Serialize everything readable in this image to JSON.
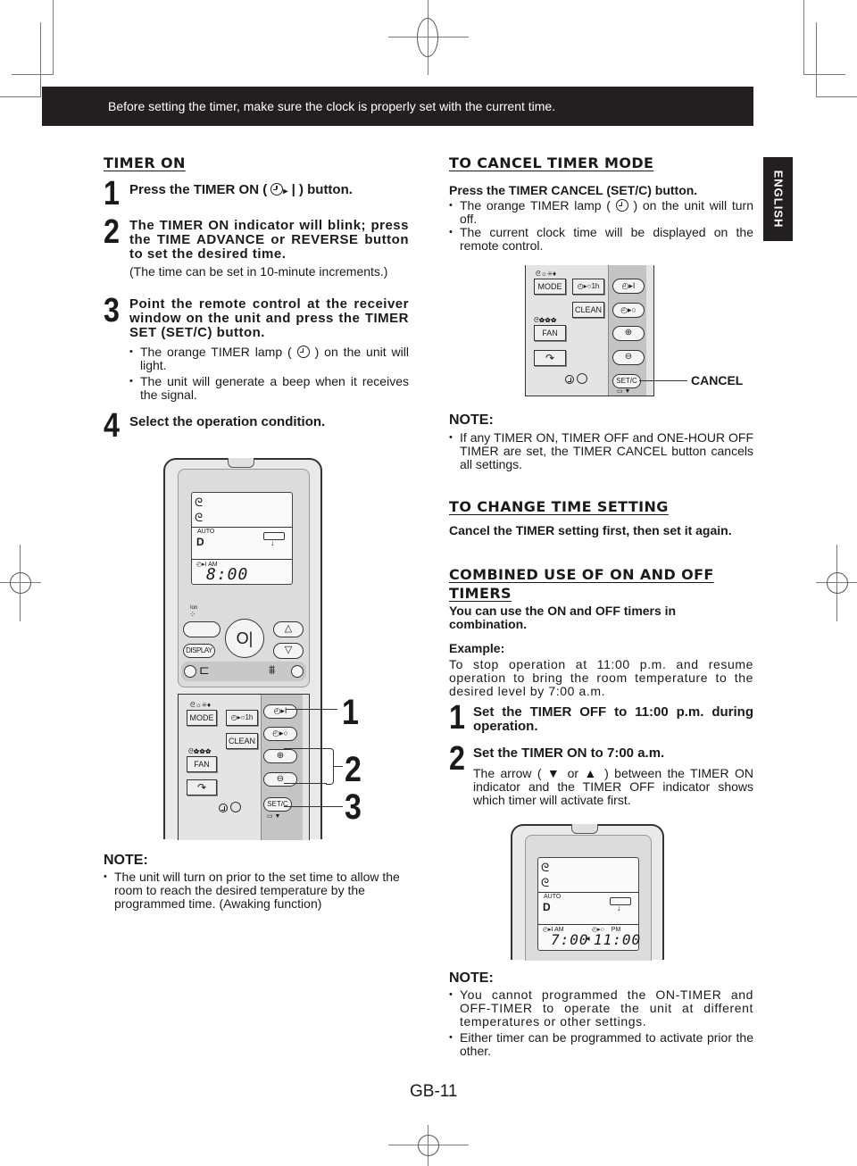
{
  "banner": "Before setting the timer, make sure the clock is properly set with the current time.",
  "language_tab": "ENGLISH",
  "page_number": "GB-11",
  "timer_on": {
    "heading": "TIMER ON ",
    "steps": [
      {
        "num": "1",
        "title_before": "Press the TIMER ON (",
        "title_after": ") button."
      },
      {
        "num": "2",
        "title": "The TIMER ON indicator will blink; press the TIME ADVANCE or REVERSE button to set the desired time.",
        "sub": "(The time can be set in 10-minute increments.)"
      },
      {
        "num": "3",
        "title": "Point the remote control at the receiver window on the unit and press the TIMER SET (SET/C) button.",
        "bullets": [
          {
            "before": "The orange TIMER lamp (",
            "after": ") on the unit will light."
          },
          {
            "text": "The unit will generate a beep when it receives the signal."
          }
        ]
      },
      {
        "num": "4",
        "title": "Select the operation condition."
      }
    ],
    "callouts": [
      "1",
      "2",
      "3"
    ],
    "note": {
      "title": "NOTE:",
      "bullets": [
        "The unit will turn on prior to the set time to allow the room to reach the desired temperature by the programmed time. (Awaking function)"
      ]
    }
  },
  "remote": {
    "lcd": {
      "auto": "AUTO",
      "timer_on_label": "AM",
      "time": "8:00"
    },
    "ion": "Ion",
    "display": "DISPLAY",
    "buttons": {
      "mode": "MODE",
      "one_hour": "1h",
      "clean": "CLEAN",
      "fan": "FAN",
      "setc": "SET/C"
    }
  },
  "cancel": {
    "heading": "TO CANCEL TIMER MODE",
    "instruction": "Press the TIMER CANCEL (SET/C) button.",
    "bullets": [
      {
        "before": "The orange TIMER lamp (",
        "after": ") on the unit will turn off."
      },
      {
        "text": "The current clock time will be displayed on the remote control."
      }
    ],
    "callout_label": "CANCEL",
    "note": {
      "title": "NOTE:",
      "bullets": [
        "If any TIMER ON, TIMER OFF and ONE-HOUR OFF TIMER are set, the TIMER CANCEL button cancels all settings."
      ]
    }
  },
  "change_time": {
    "heading": "TO CHANGE TIME SETTING",
    "instruction": "Cancel the TIMER setting first, then set it again."
  },
  "combined": {
    "heading": "COMBINED USE OF ON AND OFF TIMERS",
    "intro": "You can use the ON and OFF timers in combination.",
    "example_label": "Example:",
    "example_text": "To stop operation at 11:00 p.m. and resume operation to bring the room temperature to the desired level by 7:00 a.m.",
    "steps": [
      {
        "num": "1",
        "title": "Set the TIMER OFF to 11:00 p.m. during operation."
      },
      {
        "num": "2",
        "title": "Set the TIMER ON to 7:00 a.m.",
        "body": "The arrow ( ▼ or ▲ ) between the TIMER ON indicator and the TIMER OFF indicator shows which timer will activate first."
      }
    ],
    "lcd": {
      "auto": "AUTO",
      "on_label": "AM",
      "off_label": "PM",
      "on_time": "7:00",
      "off_time": "11:00"
    },
    "note": {
      "title": "NOTE:",
      "bullets": [
        "You cannot programmed the ON-TIMER and OFF-TIMER to operate the unit at different temperatures or other settings.",
        "Either timer can be programmed to activate prior the other."
      ]
    }
  }
}
